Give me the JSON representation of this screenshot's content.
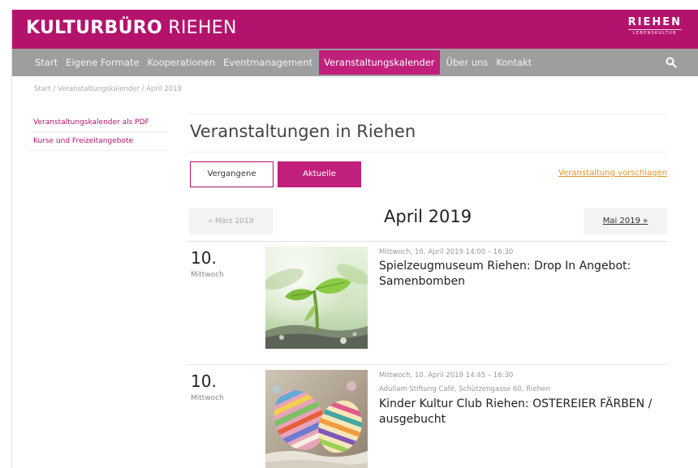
{
  "header": {
    "logo_bold": "KULTURBÜRO",
    "logo_light": "RIEHEN",
    "brand_main": "RIEHEN",
    "brand_sub": "LEBENSKULTUR"
  },
  "nav": {
    "items": [
      {
        "label": "Start"
      },
      {
        "label": "Eigene Formate"
      },
      {
        "label": "Kooperationen"
      },
      {
        "label": "Eventmanagement"
      },
      {
        "label": "Veranstaltungskalender",
        "active": true
      },
      {
        "label": "Über uns"
      },
      {
        "label": "Kontakt"
      }
    ],
    "search_icon": "search-icon"
  },
  "breadcrumb": "Start / Veranstaltungskalender / April 2019",
  "sidebar": {
    "items": [
      {
        "label": "Veranstaltungskalender als PDF"
      },
      {
        "label": "Kurse und Freizeitangebote"
      }
    ]
  },
  "main": {
    "title": "Veranstaltungen in Riehen",
    "filter": {
      "past_label": "Vergangene",
      "current_label": "Aktuelle",
      "suggest_label": "Veranstaltung vorschlagen"
    },
    "month": {
      "prev_label": "« März 2019",
      "current": "April 2019",
      "next_label": "Mai 2019 »"
    },
    "events": [
      {
        "day": "10.",
        "weekday": "Mittwoch",
        "datetime": "Mittwoch, 10. April 2019 14:00 – 16:30",
        "location": "",
        "title": "Spielzeugmuseum Riehen:  Drop In Angebot: Samenbomben",
        "image": "seedling"
      },
      {
        "day": "10.",
        "weekday": "Mittwoch",
        "datetime": "Mittwoch, 10. April 2019 14:45 – 16:30",
        "location": "Adullam Stiftung Café, Schützengasse 60, Riehen",
        "title": "Kinder Kultur Club Riehen:  OSTEREIER FÄRBEN / ausgebucht",
        "image": "easter-eggs"
      }
    ]
  },
  "colors": {
    "brand": "#b4136d",
    "nav_bg": "#9e9e9e",
    "accent_link": "#e1932c"
  }
}
